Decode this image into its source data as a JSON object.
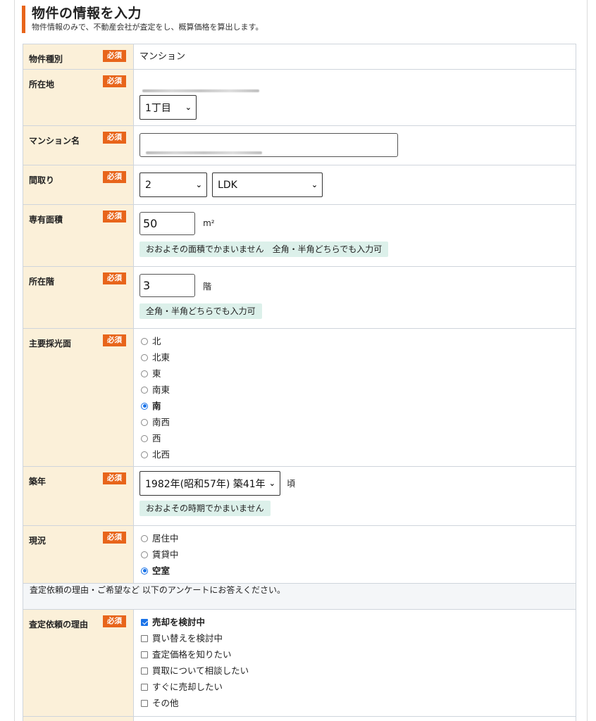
{
  "header": {
    "title": "物件の情報を入力",
    "subtitle": "物件情報のみで、不動産会社が査定をし、概算価格を算出します。"
  },
  "required_label": "必須",
  "fields": {
    "property_type": {
      "label": "物件種別",
      "value": "マンション"
    },
    "address": {
      "label": "所在地",
      "chome": "1丁目"
    },
    "mansion_name": {
      "label": "マンション名"
    },
    "layout": {
      "label": "間取り",
      "rooms": "2",
      "type": "LDK"
    },
    "area": {
      "label": "専有面積",
      "value": "50",
      "unit": "m²",
      "hint": "おおよその面積でかまいません　全角・半角どちらでも入力可"
    },
    "floor": {
      "label": "所在階",
      "value": "3",
      "unit": "階",
      "hint": "全角・半角どちらでも入力可"
    },
    "lighting": {
      "label": "主要採光面",
      "options": [
        "北",
        "北東",
        "東",
        "南東",
        "南",
        "南西",
        "西",
        "北西"
      ],
      "selected": "南"
    },
    "built_year": {
      "label": "築年",
      "value": "1982年(昭和57年) 築41年",
      "suffix": "頃",
      "hint": "おおよその時期でかまいません"
    },
    "status": {
      "label": "現況",
      "options": [
        "居住中",
        "賃貸中",
        "空室"
      ],
      "selected": "空室"
    }
  },
  "survey_note": "査定依頼の理由・ご希望など 以下のアンケートにお答えください。",
  "reason": {
    "label": "査定依頼の理由",
    "options": [
      "売却を検討中",
      "買い替えを検討中",
      "査定価格を知りたい",
      "買取について相談したい",
      "すぐに売却したい",
      "その他"
    ],
    "checked": [
      "売却を検討中"
    ]
  }
}
